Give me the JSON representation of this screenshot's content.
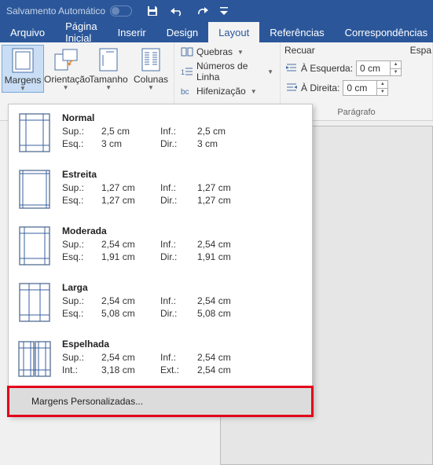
{
  "titlebar": {
    "autosave": "Salvamento Automático"
  },
  "tabs": [
    "Arquivo",
    "Página Inicial",
    "Inserir",
    "Design",
    "Layout",
    "Referências",
    "Correspondências"
  ],
  "active_tab": 4,
  "ribbon": {
    "page_setup": {
      "margins": "Margens",
      "orientation": "Orientação",
      "size": "Tamanho",
      "columns": "Colunas"
    },
    "arrange": {
      "breaks": "Quebras",
      "line_numbers": "Números de Linha",
      "hyphenation": "Hifenização"
    },
    "paragraph": {
      "recuar": "Recuar",
      "espa": "Espa",
      "left_label": "À Esquerda:",
      "right_label": "À Direita:",
      "left_val": "0 cm",
      "right_val": "0 cm",
      "group_label": "Parágrafo"
    }
  },
  "margins_menu": {
    "items": [
      {
        "name": "Normal",
        "l1a": "Sup.:",
        "l1b": "2,5 cm",
        "l1c": "Inf.:",
        "l1d": "2,5 cm",
        "l2a": "Esq.:",
        "l2b": "3 cm",
        "l2c": "Dir.:",
        "l2d": "3 cm"
      },
      {
        "name": "Estreita",
        "l1a": "Sup.:",
        "l1b": "1,27 cm",
        "l1c": "Inf.:",
        "l1d": "1,27 cm",
        "l2a": "Esq.:",
        "l2b": "1,27 cm",
        "l2c": "Dir.:",
        "l2d": "1,27 cm"
      },
      {
        "name": "Moderada",
        "l1a": "Sup.:",
        "l1b": "2,54 cm",
        "l1c": "Inf.:",
        "l1d": "2,54 cm",
        "l2a": "Esq.:",
        "l2b": "1,91 cm",
        "l2c": "Dir.:",
        "l2d": "1,91 cm"
      },
      {
        "name": "Larga",
        "l1a": "Sup.:",
        "l1b": "2,54 cm",
        "l1c": "Inf.:",
        "l1d": "2,54 cm",
        "l2a": "Esq.:",
        "l2b": "5,08 cm",
        "l2c": "Dir.:",
        "l2d": "5,08 cm"
      },
      {
        "name": "Espelhada",
        "l1a": "Sup.:",
        "l1b": "2,54 cm",
        "l1c": "Inf.:",
        "l1d": "2,54 cm",
        "l2a": "Int.:",
        "l2b": "3,18 cm",
        "l2c": "Ext.:",
        "l2d": "2,54 cm"
      }
    ],
    "custom": "Margens Personalizadas..."
  }
}
